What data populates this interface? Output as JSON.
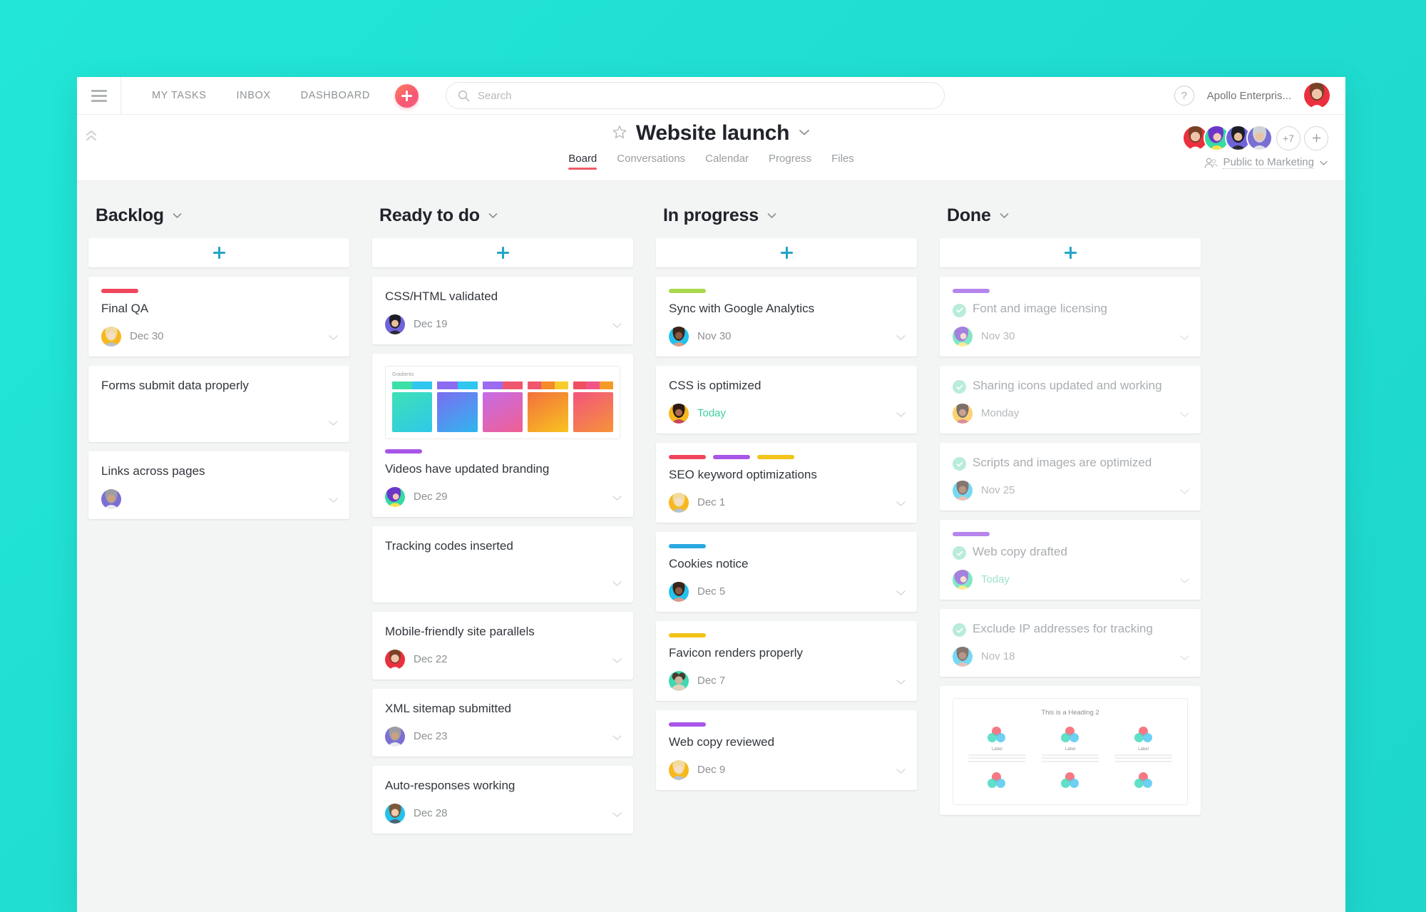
{
  "topbar": {
    "menu_icon": "hamburger-icon",
    "nav": [
      {
        "label": "MY TASKS"
      },
      {
        "label": "INBOX"
      },
      {
        "label": "DASHBOARD"
      }
    ],
    "add_button_icon": "plus-icon",
    "search": {
      "placeholder": "Search",
      "value": "",
      "icon": "search-icon"
    },
    "help_label": "?",
    "org_name": "Apollo Enterpris...",
    "user_avatar": "avatar-woman-red"
  },
  "project": {
    "star_icon": "star-icon",
    "title": "Website launch",
    "caret_icon": "chevron-down-icon",
    "collapse_icon": "double-chevron-up-icon",
    "tabs": [
      {
        "label": "Board",
        "active": true
      },
      {
        "label": "Conversations",
        "active": false
      },
      {
        "label": "Calendar",
        "active": false
      },
      {
        "label": "Progress",
        "active": false
      },
      {
        "label": "Files",
        "active": false
      }
    ],
    "members_overflow": "+7",
    "add_member_icon": "plus-icon",
    "privacy_label": "Public to Marketing",
    "privacy_icon": "people-icon"
  },
  "colors": {
    "accent_teal": "#23e0d5",
    "add_plus": "#23a5c4",
    "tab_underline": "#f05a68",
    "tag_red": "#f0465c",
    "tag_purple": "#a855e8",
    "tag_green": "#a8d84b",
    "tag_yellow": "#f2c31a",
    "tag_blue": "#2aa8e0",
    "check_bg": "#b9ecd9",
    "today_green": "#3fd0a0"
  },
  "board": {
    "add_card_label": "+",
    "columns": [
      {
        "title": "Backlog",
        "cards": [
          {
            "title": "Final QA",
            "tags": [
              "#f0465c"
            ],
            "due": "Dec 30",
            "due_today": false,
            "avatar": "avatar-blonde-yellow",
            "done": false
          },
          {
            "title": "Forms submit data properly",
            "tags": [],
            "due": "",
            "due_today": false,
            "avatar": "",
            "done": false
          },
          {
            "title": "Links across pages",
            "tags": [],
            "due": "",
            "due_today": false,
            "avatar": "avatar-man-purple",
            "done": false
          }
        ]
      },
      {
        "title": "Ready to do",
        "cards": [
          {
            "title": "CSS/HTML validated",
            "tags": [],
            "due": "Dec 19",
            "due_today": false,
            "avatar": "avatar-man-indigo",
            "done": false
          },
          {
            "title": "Videos have updated branding",
            "tags": [
              "#a855e8"
            ],
            "due": "Dec 29",
            "due_today": false,
            "avatar": "avatar-purplehair-green",
            "done": false,
            "attachment": {
              "type": "gradients",
              "label": "Gradients",
              "swatches": [
                {
                  "bar": [
                    "#3ddfa8",
                    "#2fc6ef"
                  ],
                  "big": [
                    "#3ee0b6",
                    "#2fc9e8"
                  ]
                },
                {
                  "bar": [
                    "#8b6cf0",
                    "#2fc6ef"
                  ],
                  "big": [
                    "#7b6cf2",
                    "#2fb7ee"
                  ]
                },
                {
                  "bar": [
                    "#9c6cf0",
                    "#f0566e"
                  ],
                  "big": [
                    "#c66ce8",
                    "#ef5f92"
                  ]
                },
                {
                  "bar": [
                    "#f0566e",
                    "#f58a2a",
                    "#f7cb2b"
                  ],
                  "big": [
                    "#f2703e",
                    "#f9c31f"
                  ]
                },
                {
                  "bar": [
                    "#ef4f5e",
                    "#f2548a",
                    "#f59a28"
                  ],
                  "big": [
                    "#f2547e",
                    "#f79338"
                  ]
                }
              ]
            }
          },
          {
            "title": "Tracking codes inserted",
            "tags": [],
            "due": "",
            "due_today": false,
            "avatar": "",
            "done": false
          },
          {
            "title": "Mobile-friendly site parallels",
            "tags": [],
            "due": "Dec 22",
            "due_today": false,
            "avatar": "avatar-woman-red",
            "done": false
          },
          {
            "title": "XML sitemap submitted",
            "tags": [],
            "due": "Dec 23",
            "due_today": false,
            "avatar": "avatar-man-purple",
            "done": false
          },
          {
            "title": "Auto-responses working",
            "tags": [],
            "due": "Dec 28",
            "due_today": false,
            "avatar": "avatar-glasses-cyan",
            "done": false
          }
        ]
      },
      {
        "title": "In progress",
        "cards": [
          {
            "title": "Sync with Google Analytics",
            "tags": [
              "#a8d84b"
            ],
            "due": "Nov 30",
            "due_today": false,
            "avatar": "avatar-man-cyan",
            "done": false
          },
          {
            "title": "CSS is optimized",
            "tags": [],
            "due": "Today",
            "due_today": true,
            "avatar": "avatar-woman-orange",
            "done": false
          },
          {
            "title": "SEO keyword optimizations",
            "tags": [
              "#f0465c",
              "#a855e8",
              "#f2c31a"
            ],
            "due": "Dec 1",
            "due_today": false,
            "avatar": "avatar-blonde-yellow",
            "done": false
          },
          {
            "title": "Cookies notice",
            "tags": [
              "#2aa8e0"
            ],
            "due": "Dec 5",
            "due_today": false,
            "avatar": "avatar-man-cyan",
            "done": false
          },
          {
            "title": "Favicon renders properly",
            "tags": [
              "#f2c31a"
            ],
            "due": "Dec 7",
            "due_today": false,
            "avatar": "avatar-dog-green",
            "done": false
          },
          {
            "title": "Web copy reviewed",
            "tags": [
              "#a855e8"
            ],
            "due": "Dec 9",
            "due_today": false,
            "avatar": "avatar-blonde-yellow",
            "done": false
          }
        ]
      },
      {
        "title": "Done",
        "cards": [
          {
            "title": "Font and image licensing",
            "tags": [
              "#b585ec"
            ],
            "due": "Nov 30",
            "due_today": false,
            "avatar": "avatar-purplehair-green",
            "done": true
          },
          {
            "title": "Sharing icons updated and working",
            "tags": [],
            "due": "Monday",
            "due_today": false,
            "avatar": "avatar-woman-orange",
            "done": true
          },
          {
            "title": "Scripts and images are optimized",
            "tags": [],
            "due": "Nov 25",
            "due_today": false,
            "avatar": "avatar-man-cyan",
            "done": true
          },
          {
            "title": "Web copy drafted",
            "tags": [
              "#b585ec"
            ],
            "due": "Today",
            "due_today": true,
            "avatar": "avatar-purplehair-green",
            "done": true
          },
          {
            "title": "Exclude IP addresses for tracking",
            "tags": [],
            "due": "Nov 18",
            "due_today": false,
            "avatar": "avatar-man-cyan",
            "done": true
          },
          {
            "title": "",
            "tags": [],
            "due": "",
            "due_today": false,
            "avatar": "",
            "done": true,
            "attachment": {
              "type": "document",
              "heading": "This is a Heading 2",
              "labels": [
                "Label",
                "Label",
                "Label"
              ]
            }
          }
        ]
      }
    ]
  }
}
